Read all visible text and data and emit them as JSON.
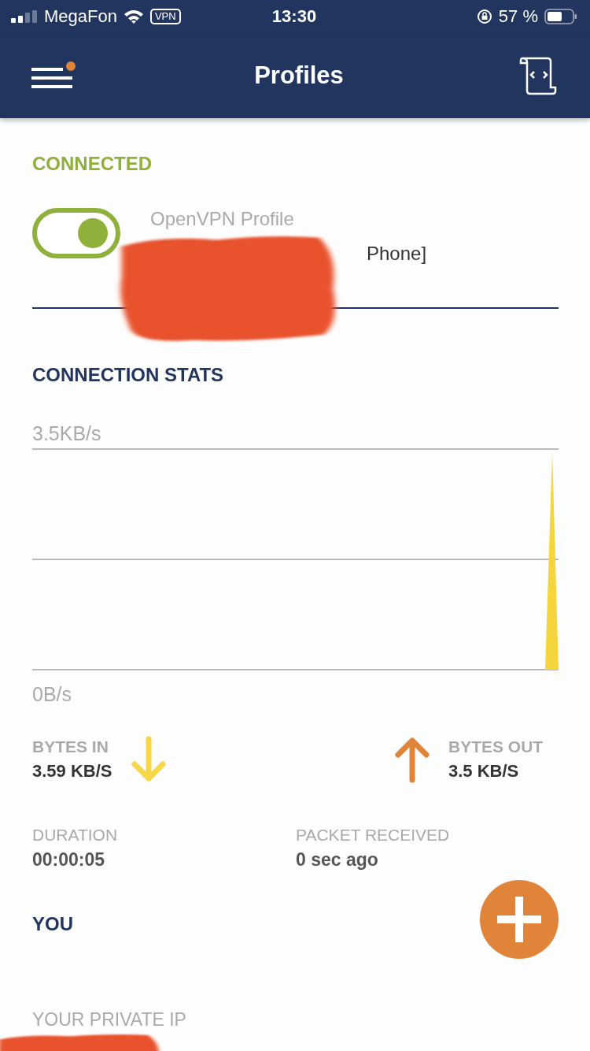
{
  "status_bar": {
    "carrier": "MegaFon",
    "vpn_badge": "VPN",
    "time": "13:30",
    "battery": "57 %"
  },
  "header": {
    "title": "Profiles",
    "menu_notification": true
  },
  "connection": {
    "status": "CONNECTED",
    "profile": {
      "on": true,
      "name": "OpenVPN Profile",
      "detail": "Phone]"
    }
  },
  "stats": {
    "title": "CONNECTION STATS",
    "max_label": "3.5KB/s",
    "min_label": "0B/s",
    "items": [
      {
        "kind": "bytes_in",
        "label": "BYTES IN",
        "value": "3.59 KB/S"
      },
      {
        "kind": "bytes_out",
        "label": "BYTES OUT",
        "value": "3.5 KB/S"
      },
      {
        "kind": "plain",
        "label": "DURATION",
        "value": "00:00:05"
      },
      {
        "kind": "plain",
        "label": "PACKET RECEIVED",
        "value": "0 sec ago"
      }
    ]
  },
  "you": {
    "title": "YOU",
    "items": [
      {
        "label": "YOUR PRIVATE IP"
      }
    ]
  }
}
